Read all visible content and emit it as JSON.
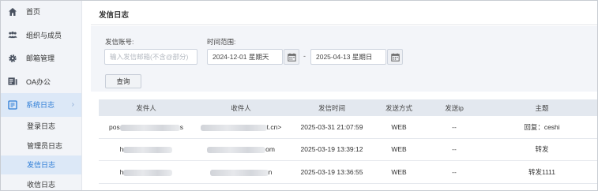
{
  "sidebar": {
    "items": [
      {
        "label": "首页",
        "icon": "home-icon"
      },
      {
        "label": "组织与成员",
        "icon": "users-icon"
      },
      {
        "label": "邮箱管理",
        "icon": "gear-icon"
      },
      {
        "label": "OA办公",
        "icon": "oa-icon"
      },
      {
        "label": "系统日志",
        "icon": "log-icon",
        "active": true
      }
    ],
    "subitems": [
      {
        "label": "登录日志"
      },
      {
        "label": "管理员日志"
      },
      {
        "label": "发信日志",
        "current": true
      },
      {
        "label": "收信日志"
      }
    ]
  },
  "page": {
    "title": "发信日志"
  },
  "filters": {
    "account_label": "发信账号:",
    "account_placeholder": "输入发信邮箱(不含@部分)",
    "time_label": "时间范围:",
    "start_date": "2024-12-01 星期天",
    "end_date": "2025-04-13 星期日",
    "range_separator": "-",
    "query_button": "查询"
  },
  "table": {
    "columns": [
      "发件人",
      "收件人",
      "发信时间",
      "发送方式",
      "发送ip",
      "主题"
    ],
    "rows": [
      {
        "sender_prefix": "pos",
        "sender_suffix": "s",
        "recipient_prefix": "",
        "recipient_suffix": "t.cn>",
        "time": "2025-03-31 21:07:59",
        "method": "WEB",
        "ip": "--",
        "subject": "回复：ceshi"
      },
      {
        "sender_prefix": "h",
        "sender_suffix": "",
        "recipient_prefix": "",
        "recipient_suffix": "om",
        "time": "2025-03-19 13:39:12",
        "method": "WEB",
        "ip": "--",
        "subject": "转发"
      },
      {
        "sender_prefix": "h",
        "sender_suffix": "",
        "recipient_prefix": "",
        "recipient_suffix": "n",
        "time": "2025-03-19 13:36:55",
        "method": "WEB",
        "ip": "--",
        "subject": "转发1111"
      }
    ]
  },
  "colors": {
    "accent": "#2b7bd6",
    "sidebar_bg": "#f2f4f8",
    "active_bg": "#dce8f7",
    "header_bg": "#e3e8ef"
  }
}
